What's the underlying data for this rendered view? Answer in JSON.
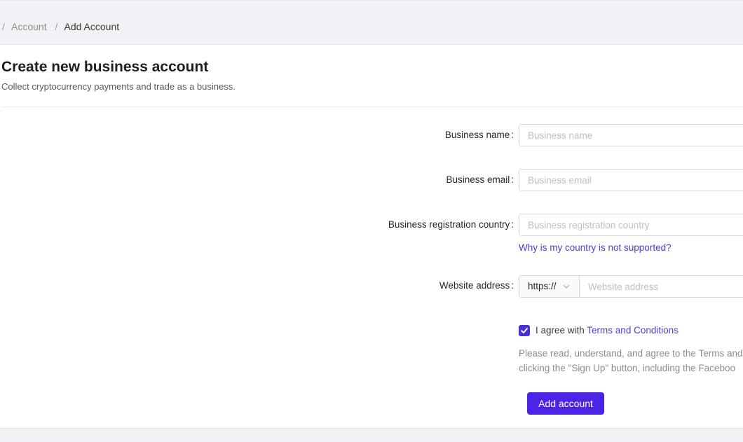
{
  "breadcrumb": {
    "separator": "/",
    "items": [
      "Account",
      "Add Account"
    ]
  },
  "header": {
    "title": "Create new business account",
    "subtitle": "Collect cryptocurrency payments and trade as a business."
  },
  "form": {
    "colon": ":",
    "business_name": {
      "label": "Business name",
      "placeholder": "Business name",
      "value": ""
    },
    "business_email": {
      "label": "Business email",
      "placeholder": "Business email",
      "value": ""
    },
    "country": {
      "label": "Business registration country",
      "placeholder": "Business registration country",
      "value": "",
      "help_link": "Why is my country is not supported?"
    },
    "website": {
      "label": "Website address",
      "protocol": "https://",
      "placeholder": "Website address",
      "value": ""
    },
    "agreement": {
      "checked": true,
      "prefix": "I agree with ",
      "terms_link": "Terms and Conditions",
      "note_line1": "Please read, understand, and agree to the Terms and",
      "note_line2": "clicking the \"Sign Up\" button, including the Faceboo"
    },
    "submit_label": "Add account"
  },
  "colors": {
    "accent": "#4b23e6",
    "link": "#4b3fd6",
    "checkbox": "#4b2ed8"
  },
  "icons": {
    "protocol_dropdown": "chevron-down-icon",
    "checkbox": "check-icon"
  }
}
